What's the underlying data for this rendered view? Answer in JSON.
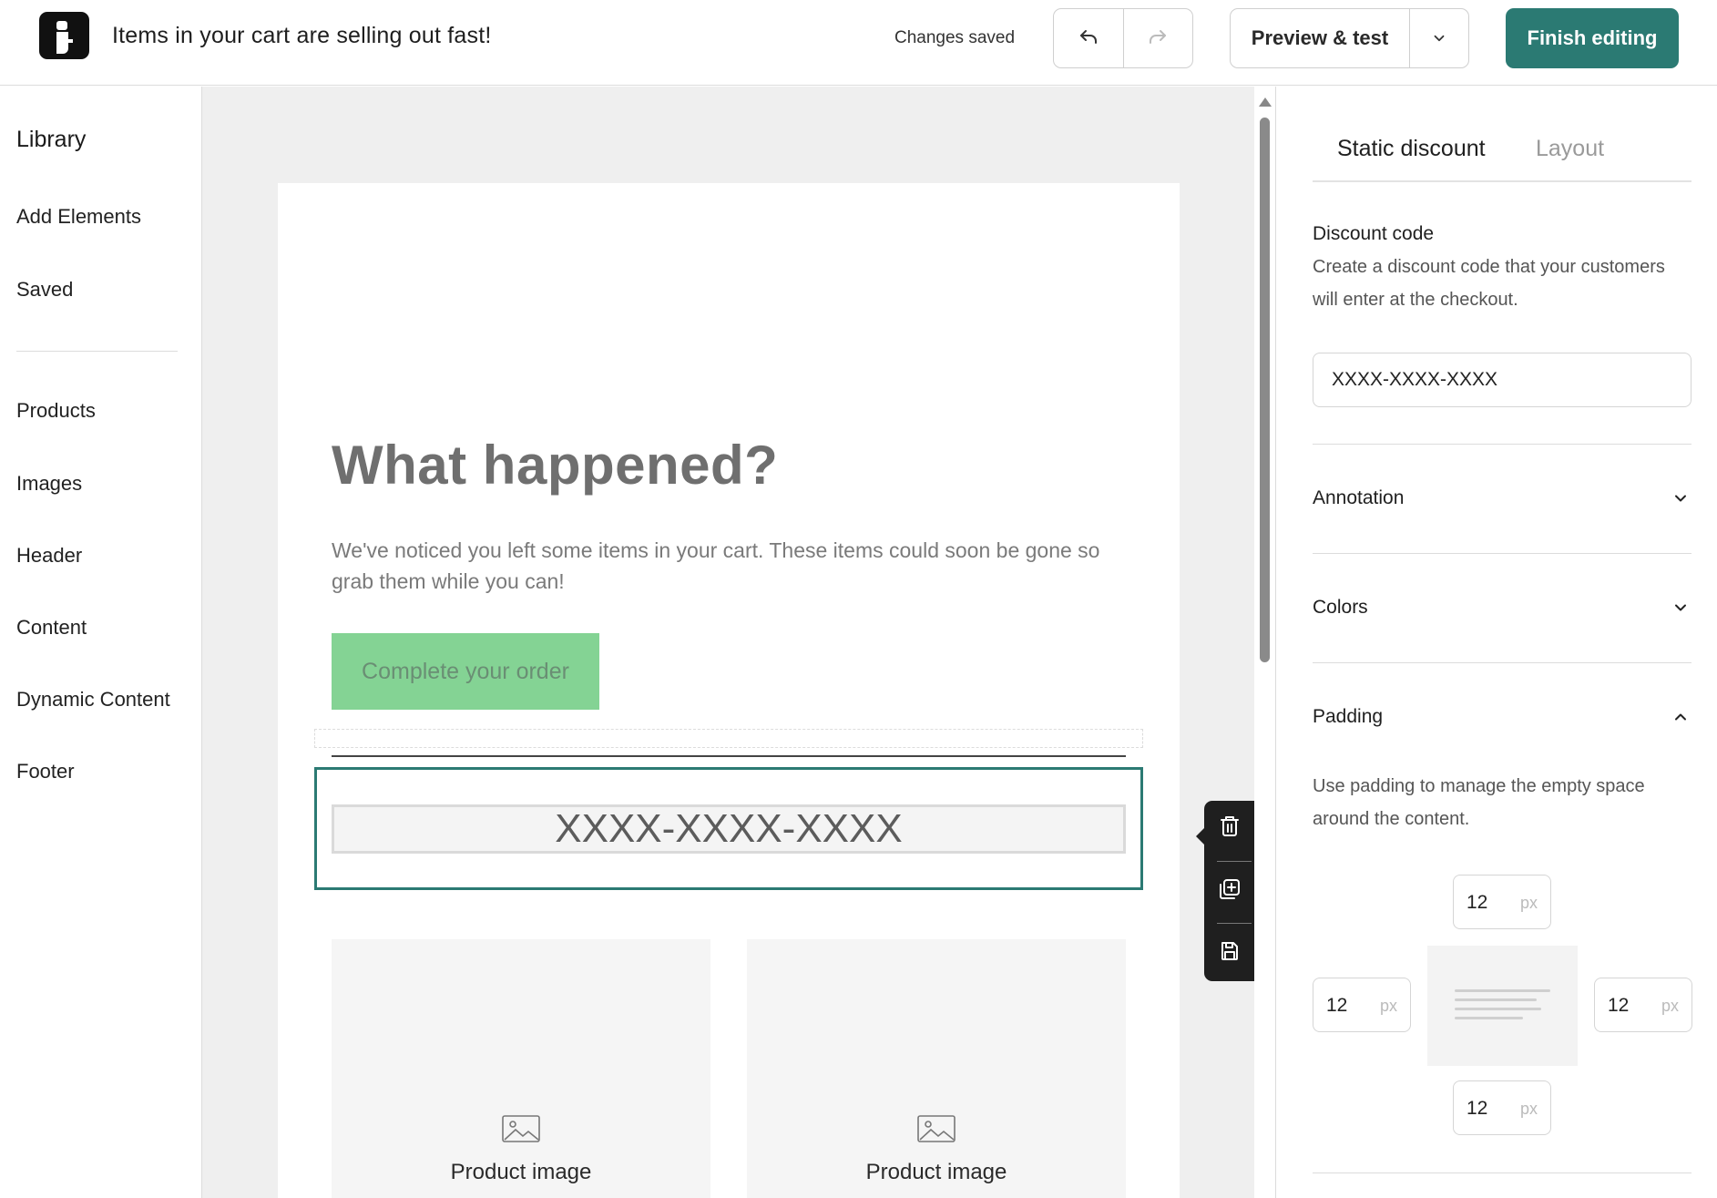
{
  "app": {
    "title": "Items in your cart are selling out fast!",
    "status": "Changes saved",
    "preview_label": "Preview & test",
    "finish_label": "Finish editing",
    "accent_color": "#2b7a73"
  },
  "sidebar": {
    "title": "Library",
    "items_top": [
      {
        "label": "Add Elements"
      },
      {
        "label": "Saved"
      }
    ],
    "items_bottom": [
      {
        "label": "Products"
      },
      {
        "label": "Images"
      },
      {
        "label": "Header"
      },
      {
        "label": "Content"
      },
      {
        "label": "Dynamic Content"
      },
      {
        "label": "Footer"
      }
    ]
  },
  "email": {
    "headline": "What happened?",
    "paragraph": "We've noticed you left some items in your cart. These items could soon be gone so grab them while you can!",
    "cta_label": "Complete your order",
    "cta_color": "#84d394",
    "discount_code": "XXXX-XXXX-XXXX",
    "products": [
      {
        "label": "Product image",
        "icon": "image-placeholder-icon"
      },
      {
        "label": "Product image",
        "icon": "image-placeholder-icon"
      }
    ]
  },
  "floating_toolbar": {
    "actions": [
      "trash-icon",
      "duplicate-icon",
      "save-icon"
    ]
  },
  "panel": {
    "tabs": [
      {
        "label": "Static discount",
        "active": true
      },
      {
        "label": "Layout",
        "active": false
      }
    ],
    "discount": {
      "label": "Discount code",
      "description": "Create a discount code that your customers will enter at the checkout.",
      "value": "XXXX-XXXX-XXXX"
    },
    "sections": {
      "annotation": "Annotation",
      "colors": "Colors",
      "padding": "Padding"
    },
    "padding": {
      "description": "Use padding to manage the empty space around the content.",
      "top": "12",
      "left": "12",
      "right": "12",
      "bottom": "12",
      "unit": "px"
    }
  }
}
